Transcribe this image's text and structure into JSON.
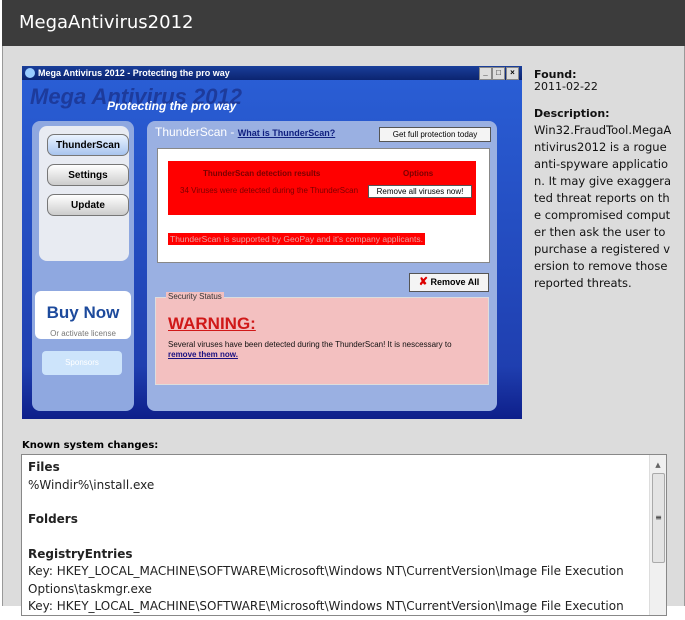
{
  "header": {
    "title": "MegaAntivirus2012"
  },
  "screenshot": {
    "window_title": "Mega Antivirus 2012 - Protecting the pro way",
    "brand": "Mega Antivirus 2012",
    "tagline": "Protecting the pro way",
    "nav": [
      "ThunderScan",
      "Settings",
      "Update"
    ],
    "buy_now": "Buy Now",
    "activate": "Or activate license",
    "sponsors": "Sponsors",
    "section_title": "ThunderScan - ",
    "what_is": "What is ThunderScan?",
    "get_protection": "Get full protection today",
    "results_header": "ThunderScan detection results",
    "options_header": "Options",
    "result_text": "34 Viruses were detected during the ThunderScan",
    "remove_all_viruses": "Remove all viruses now!",
    "supported": "ThunderScan is supported by GeoPay and it's company applicants.",
    "remove_all": "Remove All",
    "security_status": "Security Status",
    "warning": "WARNING:",
    "warning_text": "Several viruses have been detected during the ThunderScan! It is nescessary to ",
    "remove_link": "remove them now."
  },
  "info": {
    "found_label": "Found:",
    "found": "2011-02-22",
    "desc_label": "Description:",
    "desc": "Win32.FraudTool.MegaAntivirus2012 is a rogue anti-spyware application. It may give exaggerated threat reports on the compromised computer then ask the user to purchase a registered version to remove those reported threats."
  },
  "changes": {
    "label": "Known system changes:",
    "files_h": "Files",
    "file1": "%Windir%\\install.exe",
    "folders_h": "Folders",
    "reg_h": "RegistryEntries",
    "reg1": "Key: HKEY_LOCAL_MACHINE\\SOFTWARE\\Microsoft\\Windows NT\\CurrentVersion\\Image File Execution Options\\taskmgr.exe",
    "reg2": "Key: HKEY_LOCAL_MACHINE\\SOFTWARE\\Microsoft\\Windows NT\\CurrentVersion\\Image File Execution"
  }
}
